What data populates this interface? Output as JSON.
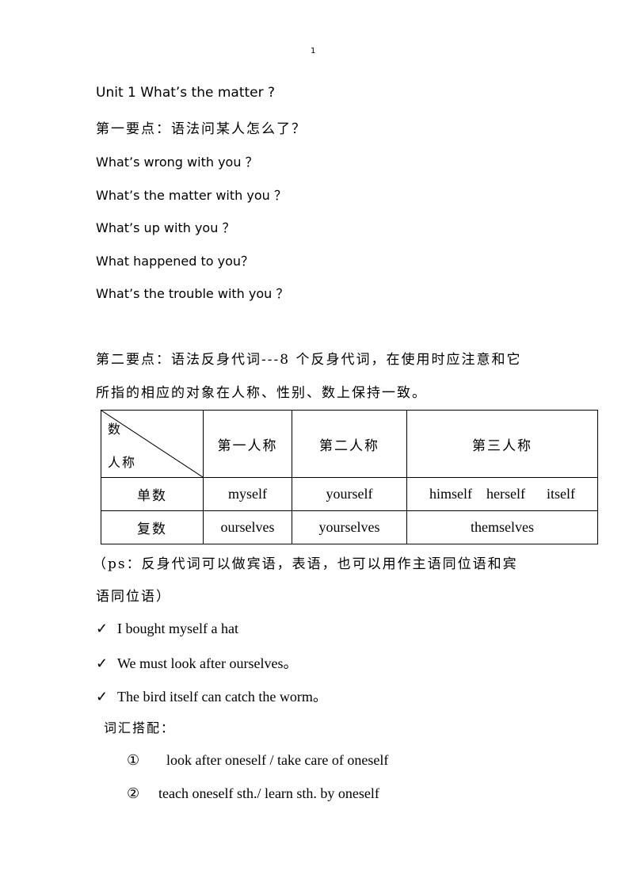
{
  "page_number": "1",
  "title": "Unit 1 What’s the matter ?",
  "point1": {
    "heading": "第一要点：语法问某人怎么了？",
    "questions": [
      "What’s wrong with you  ？",
      "What’s the matter with you  ？",
      "What’s up with you  ？",
      "What happened to you？",
      "What’s the trouble with you  ？"
    ]
  },
  "point2": {
    "heading_line1": "第二要点：语法反身代词---8 个反身代词，在使用时应注意和它",
    "heading_line2": "所指的相应的对象在人称、性别、数上保持一致。"
  },
  "table": {
    "corner_top": "数",
    "corner_bottom": "人称",
    "headers": [
      "第一人称",
      "第二人称",
      "第三人称"
    ],
    "rows": [
      {
        "label": "单数",
        "cells": [
          "myself",
          "yourself",
          "himself    herself      itself"
        ]
      },
      {
        "label": "复数",
        "cells": [
          "ourselves",
          "yourselves",
          "themselves"
        ]
      }
    ]
  },
  "note": {
    "line1": "（ps：反身代词可以做宾语，表语，也可以用作主语同位语和宾",
    "line2": "语同位语）"
  },
  "examples": [
    "I bought myself a hat",
    "We must look after ourselves。",
    "The bird itself can catch the worm。"
  ],
  "check_icon": "✓",
  "collocations": {
    "heading": "词汇搭配：",
    "items": [
      {
        "marker": "①",
        "text": "look after oneself / take care of oneself"
      },
      {
        "marker": "②",
        "text": "teach oneself sth./ learn sth. by oneself"
      }
    ]
  }
}
